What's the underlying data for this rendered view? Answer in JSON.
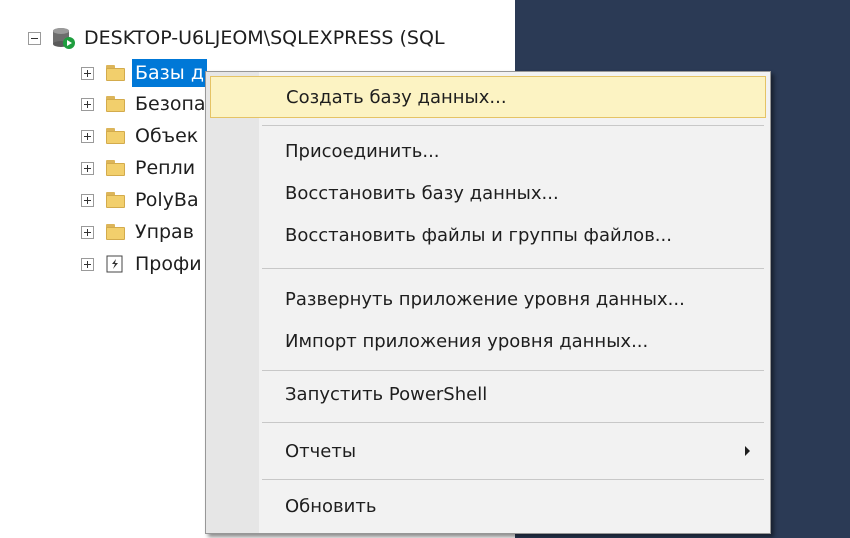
{
  "tree": {
    "server_label": "DESKTOP-U6LJEOM\\SQLEXPRESS (SQL",
    "items": [
      {
        "label": "Базы д",
        "icon": "folder-icon",
        "selected": true
      },
      {
        "label": "Безопа",
        "icon": "folder-icon"
      },
      {
        "label": "Объек",
        "icon": "folder-icon"
      },
      {
        "label": "Репли",
        "icon": "folder-icon"
      },
      {
        "label": "PolyBa",
        "icon": "folder-icon"
      },
      {
        "label": "Управ",
        "icon": "folder-icon"
      },
      {
        "label": "Профи",
        "icon": "xevent-profiler-icon"
      }
    ]
  },
  "context_menu": {
    "items": [
      {
        "label": "Создать базу данных..."
      },
      {
        "label": "Присоединить..."
      },
      {
        "label": "Восстановить базу данных..."
      },
      {
        "label": "Восстановить файлы и группы файлов..."
      },
      {
        "label": "Развернуть приложение уровня данных..."
      },
      {
        "label": "Импорт приложения уровня данных..."
      },
      {
        "label": "Запустить PowerShell"
      },
      {
        "label": "Отчеты",
        "has_submenu": true
      },
      {
        "label": "Обновить"
      }
    ]
  },
  "colors": {
    "selection": "#0078d7",
    "menu_hover": "#fcf3c3",
    "menu_hover_border": "#e5c365",
    "background": "#2b3a55"
  }
}
